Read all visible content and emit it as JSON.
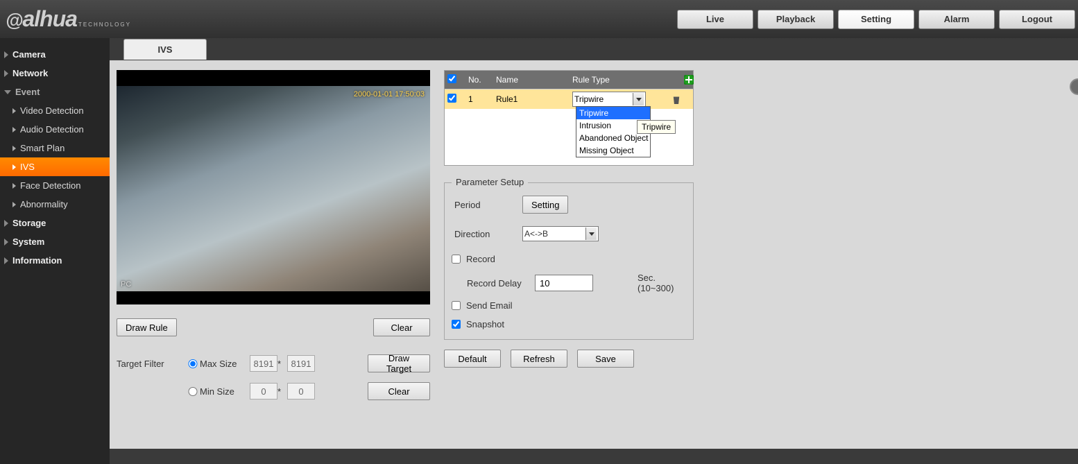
{
  "brand": {
    "name": "alhua",
    "sub": "TECHNOLOGY"
  },
  "topnav": {
    "live": "Live",
    "playback": "Playback",
    "setting": "Setting",
    "alarm": "Alarm",
    "logout": "Logout"
  },
  "sidebar": {
    "camera": "Camera",
    "network": "Network",
    "event": "Event",
    "event_items": {
      "video_detection": "Video Detection",
      "audio_detection": "Audio Detection",
      "smart_plan": "Smart Plan",
      "ivs": "IVS",
      "face_detection": "Face Detection",
      "abnormality": "Abnormality"
    },
    "storage": "Storage",
    "system": "System",
    "information": "Information"
  },
  "tab": {
    "ivs": "IVS"
  },
  "video": {
    "timestamp": "2000-01-01 17:50:03",
    "corner": "PC"
  },
  "buttons": {
    "draw_rule": "Draw Rule",
    "clear": "Clear",
    "draw_target": "Draw Target",
    "default": "Default",
    "refresh": "Refresh",
    "save": "Save",
    "setting": "Setting"
  },
  "filter": {
    "label": "Target Filter",
    "max": "Max Size",
    "min": "Min Size",
    "max_w": "8191",
    "max_h": "8191",
    "min_w": "0",
    "min_h": "0"
  },
  "rule_table": {
    "col_no": "No.",
    "col_name": "Name",
    "col_type": "Rule Type",
    "row1_no": "1",
    "row1_name": "Rule1",
    "row1_type": "Tripwire"
  },
  "dropdown": {
    "opt1": "Tripwire",
    "opt2": "Intrusion",
    "opt3": "Abandoned Object",
    "opt4": "Missing Object"
  },
  "tooltip": "Tripwire",
  "param": {
    "legend": "Parameter Setup",
    "period": "Period",
    "direction": "Direction",
    "direction_val": "A<->B",
    "record": "Record",
    "record_delay": "Record Delay",
    "record_delay_val": "10",
    "record_delay_hint": "Sec. (10~300)",
    "send_email": "Send Email",
    "snapshot": "Snapshot"
  }
}
